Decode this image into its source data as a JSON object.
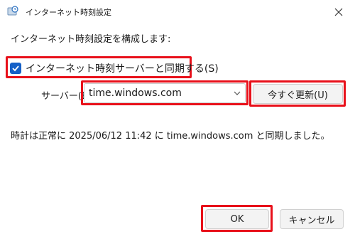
{
  "window": {
    "title": "インターネット時刻設定",
    "app_icon": "clock-globe-icon",
    "close_icon": "close-icon"
  },
  "main": {
    "section_label": "インターネット時刻設定を構成します:",
    "sync_checkbox": {
      "label": "インターネット時刻サーバーと同期する(S)",
      "checked": true
    },
    "server": {
      "label": "サーバー(E)",
      "value": "time.windows.com"
    },
    "update_button_label": "今すぐ更新(U)",
    "status_text": "時計は正常に 2025/06/12 11:42 に time.windows.com と同期しました。"
  },
  "footer": {
    "ok_label": "OK",
    "cancel_label": "キャンセル"
  },
  "colors": {
    "highlight": "#e8101a",
    "accent": "#1560c7"
  }
}
